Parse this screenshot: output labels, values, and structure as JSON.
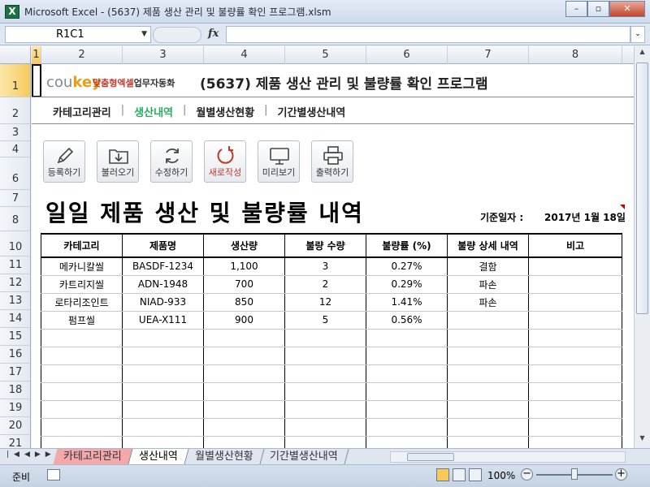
{
  "window": {
    "title": "Microsoft Excel - (5637) 제품 생산 관리 및 불량률 확인 프로그램.xlsm",
    "app_icon": "X",
    "buttons": {
      "minimize": "–",
      "restore": "▫",
      "close": "✕"
    }
  },
  "formula_bar": {
    "name_box": "R1C1",
    "fx": "fx",
    "formula": ""
  },
  "columns": [
    "1",
    "2",
    "3",
    "4",
    "5",
    "6",
    "7",
    "8"
  ],
  "rows": [
    "1",
    "2",
    "3",
    "4",
    "6",
    "7",
    "8",
    "10",
    "11",
    "12",
    "13",
    "14",
    "15",
    "16",
    "17",
    "18",
    "19",
    "20",
    "21"
  ],
  "header": {
    "logo_main": "cou",
    "logo_key": "key",
    "logo_sub_red": "맞춤형엑셀",
    "logo_sub_dark": "업무자동화",
    "program_title": "(5637) 제품 생산 관리 및 불량률 확인 프로그램"
  },
  "nav": {
    "items": [
      {
        "label": "카테고리관리",
        "active": false
      },
      {
        "label": "생산내역",
        "active": true
      },
      {
        "label": "월별생산현황",
        "active": false
      },
      {
        "label": "기간별생산내역",
        "active": false
      }
    ],
    "separator": "|"
  },
  "toolbar": {
    "register": "등록하기",
    "load": "불러오기",
    "edit": "수정하기",
    "new": "새로작성",
    "preview": "미리보기",
    "print": "출력하기"
  },
  "report": {
    "title": "일일 제품 생산 및 불량률 내역",
    "date_label": "기준일자 :",
    "date_value": "2017년 1월 18일"
  },
  "table": {
    "headers": [
      "카테고리",
      "제품명",
      "생산량",
      "불량 수량",
      "불량률 (%)",
      "불량 상세 내역",
      "비고"
    ],
    "rows": [
      [
        "메카니칼씰",
        "BASDF-1234",
        "1,100",
        "3",
        "0.27%",
        "결함",
        ""
      ],
      [
        "카트리지씰",
        "ADN-1948",
        "700",
        "2",
        "0.29%",
        "파손",
        ""
      ],
      [
        "로타리조인트",
        "NIAD-933",
        "850",
        "12",
        "1.41%",
        "파손",
        ""
      ],
      [
        "펌프씰",
        "UEA-X111",
        "900",
        "5",
        "0.56%",
        "",
        ""
      ],
      [
        "",
        "",
        "",
        "",
        "",
        "",
        ""
      ],
      [
        "",
        "",
        "",
        "",
        "",
        "",
        ""
      ],
      [
        "",
        "",
        "",
        "",
        "",
        "",
        ""
      ],
      [
        "",
        "",
        "",
        "",
        "",
        "",
        ""
      ],
      [
        "",
        "",
        "",
        "",
        "",
        "",
        ""
      ],
      [
        "",
        "",
        "",
        "",
        "",
        "",
        ""
      ],
      [
        "",
        "",
        "",
        "",
        "",
        "",
        ""
      ]
    ]
  },
  "sheet_tabs": [
    {
      "label": "카테고리관리",
      "style": "pink"
    },
    {
      "label": "생산내역",
      "style": "active"
    },
    {
      "label": "월별생산현황",
      "style": "normal"
    },
    {
      "label": "기간별생산내역",
      "style": "normal"
    }
  ],
  "status": {
    "mode": "준비",
    "zoom": "100%"
  }
}
